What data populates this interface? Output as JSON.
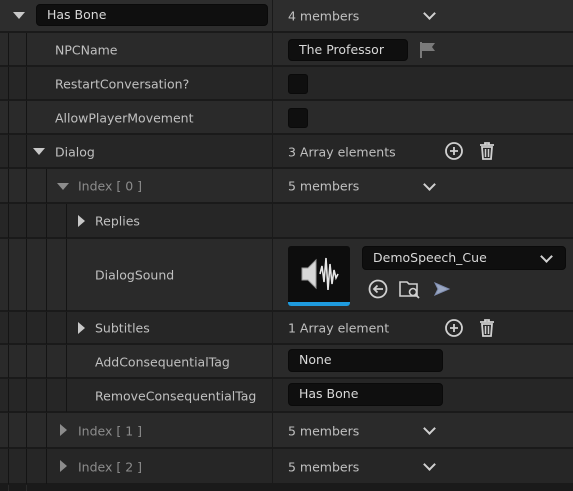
{
  "root": {
    "name_value": "Has Bone",
    "value": "4 members"
  },
  "npc_name": {
    "label": "NPCName",
    "value": "The Professor"
  },
  "restart_conversation": {
    "label": "RestartConversation?"
  },
  "allow_player_movement": {
    "label": "AllowPlayerMovement"
  },
  "dialog": {
    "label": "Dialog",
    "value": "3 Array elements"
  },
  "index0": {
    "label": "Index [ 0 ]",
    "value": "5 members"
  },
  "replies": {
    "label": "Replies"
  },
  "dialog_sound": {
    "label": "DialogSound",
    "asset": "DemoSpeech_Cue"
  },
  "subtitles": {
    "label": "Subtitles",
    "value": "1 Array element"
  },
  "add_tag": {
    "label": "AddConsequentialTag",
    "value": "None"
  },
  "remove_tag": {
    "label": "RemoveConsequentialTag",
    "value": "Has Bone"
  },
  "index1": {
    "label": "Index [ 1 ]",
    "value": "5 members"
  },
  "index2": {
    "label": "Index [ 2 ]",
    "value": "5 members"
  },
  "icons": {
    "flag": "flag-icon",
    "add": "add-element-icon",
    "delete": "trash-icon",
    "browse": "use-selected-icon",
    "find": "browse-to-asset-icon",
    "play": "play-icon",
    "sound": "sound-wave-thumbnail"
  },
  "colors": {
    "accent_blue": "#1f9bde",
    "background": "#1a1a1a",
    "row": "#2a2a2a",
    "field": "#0f0f0f"
  }
}
